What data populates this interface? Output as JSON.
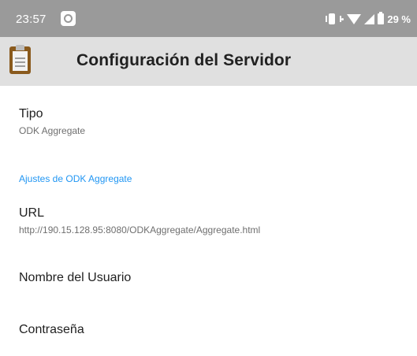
{
  "status_bar": {
    "time": "23:57",
    "battery_percent": "29 %",
    "icons": [
      "notification-icon",
      "vibrate-icon",
      "data-dot-icon",
      "wifi-icon",
      "signal-icon",
      "battery-icon"
    ]
  },
  "app_bar": {
    "icon": "clipboard-icon",
    "title": "Configuración del Servidor"
  },
  "settings": {
    "tipo": {
      "title": "Tipo",
      "summary": "ODK Aggregate"
    },
    "category_label": "Ajustes de ODK Aggregate",
    "url": {
      "title": "URL",
      "summary": "http://190.15.128.95:8080/ODKAggregate/Aggregate.html"
    },
    "username": {
      "title": "Nombre del Usuario"
    },
    "password": {
      "title": "Contraseña"
    }
  },
  "colors": {
    "status_bar": "#9a9a9a",
    "app_bar": "#e0e0e0",
    "accent": "#2196f3"
  }
}
